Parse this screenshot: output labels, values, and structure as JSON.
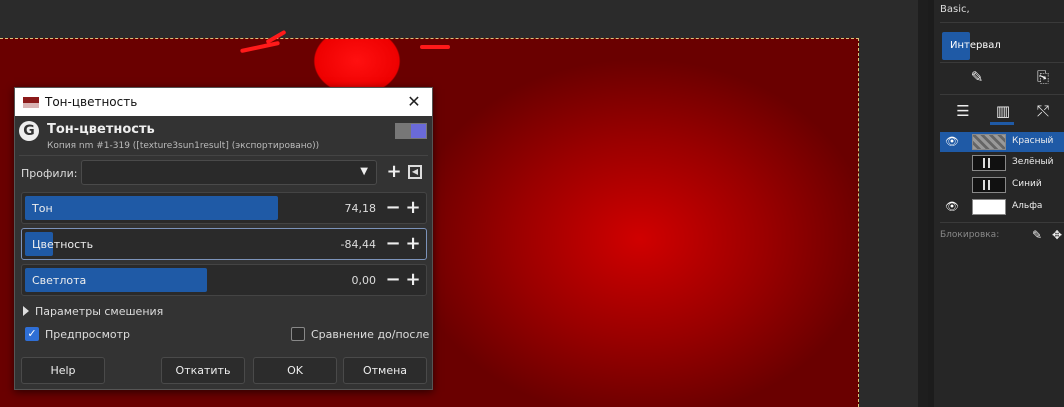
{
  "dialog": {
    "window_title": "Тон-цветность",
    "header_title": "Тон-цветность",
    "header_subtitle": "Копия nm #1-319 ([texture3sun1result] (экспортировано))",
    "profiles": {
      "label": "Профили:",
      "value": ""
    },
    "sliders": [
      {
        "label": "Тон",
        "value": "74,18",
        "fill_fraction": 0.64
      },
      {
        "label": "Цветность",
        "value": "-84,44",
        "fill_fraction": 0.07
      },
      {
        "label": "Светлота",
        "value": "0,00",
        "fill_fraction": 0.46
      }
    ],
    "blend_options_label": "Параметры смешения",
    "preview": {
      "label": "Предпросмотр",
      "checked": true
    },
    "compare": {
      "label": "Сравнение до/после",
      "checked": false
    },
    "buttons": {
      "help": "Help",
      "reset": "Откатить",
      "ok": "OK",
      "cancel": "Отмена"
    },
    "icons": {
      "title": "app-image-icon",
      "close": "close-icon",
      "logo": "gimp-logo-icon",
      "add": "plus-icon",
      "minus": "minus-icon",
      "menu": "menu-arrow-icon"
    }
  },
  "right_panel": {
    "mode_label": "Basic,",
    "interval_label": "Интервал",
    "channels": [
      {
        "name": "Красный",
        "visible": true,
        "selected": true
      },
      {
        "name": "Зелёный",
        "visible": false,
        "selected": false
      },
      {
        "name": "Синий",
        "visible": false,
        "selected": false
      },
      {
        "name": "Альфа",
        "visible": true,
        "selected": false
      }
    ],
    "lock_label": "Блокировка:"
  },
  "colors": {
    "accent": "#1f5aa6",
    "dialog_bg": "#333333",
    "canvas_red": "#cc0000"
  }
}
